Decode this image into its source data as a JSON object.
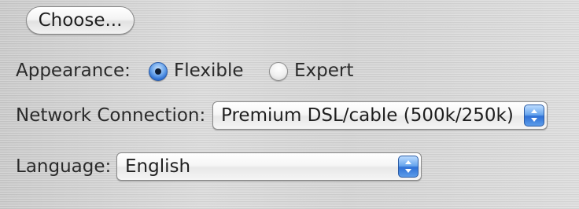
{
  "choose_button": {
    "label": "Choose..."
  },
  "appearance": {
    "label": "Appearance:",
    "options": [
      {
        "label": "Flexible",
        "selected": true
      },
      {
        "label": "Expert",
        "selected": false
      }
    ]
  },
  "network_connection": {
    "label": "Network Connection:",
    "selected_value": "Premium DSL/cable (500k/250k)"
  },
  "language": {
    "label": "Language:",
    "selected_value": "English"
  },
  "icons": {
    "radio_selected": "radio-selected-icon",
    "radio_unselected": "radio-unselected-icon",
    "popup_arrows": "up-down-arrows-icon"
  },
  "colors": {
    "accent_blue": "#2d6fd3",
    "panel_background": "#d4d4d4"
  }
}
